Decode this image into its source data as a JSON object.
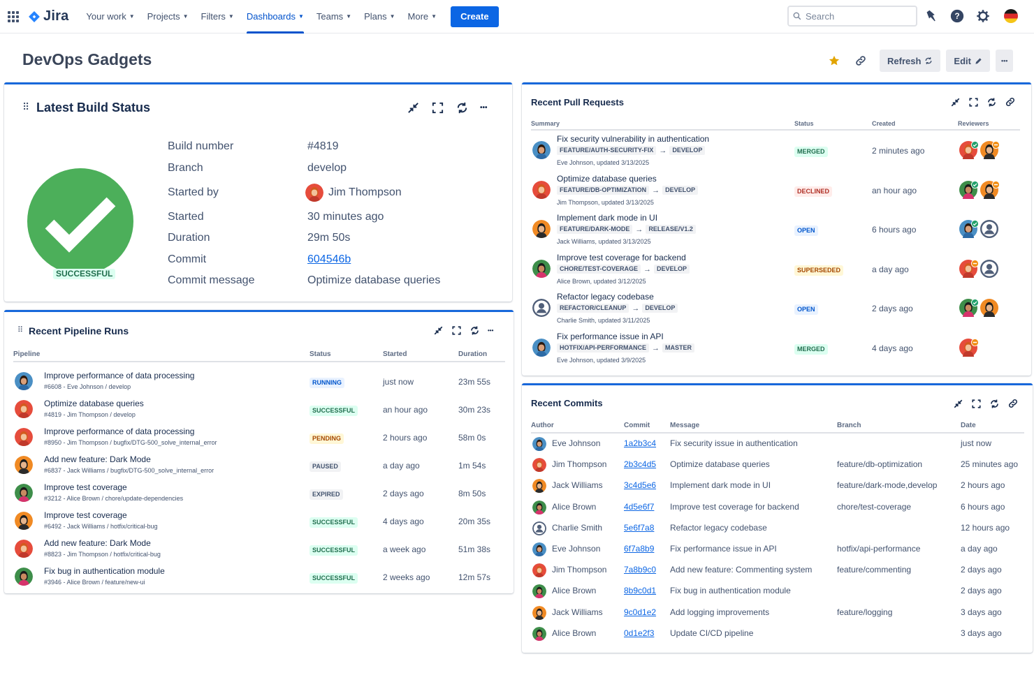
{
  "nav": {
    "logo": "Jira",
    "items": [
      {
        "label": "Your work",
        "active": false
      },
      {
        "label": "Projects",
        "active": false
      },
      {
        "label": "Filters",
        "active": false
      },
      {
        "label": "Dashboards",
        "active": true
      },
      {
        "label": "Teams",
        "active": false
      },
      {
        "label": "Plans",
        "active": false
      },
      {
        "label": "More",
        "active": false
      }
    ],
    "create_label": "Create",
    "search_placeholder": "Search",
    "icons": [
      "notifications-icon",
      "help-icon",
      "settings-icon",
      "profile-avatar"
    ]
  },
  "header": {
    "title": "DevOps Gadgets",
    "refresh_label": "Refresh",
    "edit_label": "Edit",
    "more_label": "•••"
  },
  "build": {
    "title": "Latest Build Status",
    "status": "SUCCESSFUL",
    "labels": {
      "number": "Build number",
      "branch": "Branch",
      "started_by": "Started by",
      "started": "Started",
      "duration": "Duration",
      "commit": "Commit",
      "message": "Commit message"
    },
    "values": {
      "number": "#4819",
      "branch": "develop",
      "started_by": "Jim Thompson",
      "started": "30 minutes ago",
      "duration": "29m 50s",
      "commit": "604546b",
      "message": "Optimize database queries"
    }
  },
  "pipelines": {
    "title": "Recent Pipeline Runs",
    "columns": [
      "Pipeline",
      "Status",
      "Started",
      "Duration"
    ],
    "rows": [
      {
        "title": "Improve performance of data processing",
        "sub": "#6608 - Eve Johnson / develop",
        "status": "RUNNING",
        "tone": "blue",
        "started": "just now",
        "duration": "23m 55s",
        "avatar": "eve"
      },
      {
        "title": "Optimize database queries",
        "sub": "#4819 - Jim Thompson / develop",
        "status": "SUCCESSFUL",
        "tone": "green",
        "started": "an hour ago",
        "duration": "30m 23s",
        "avatar": "jim"
      },
      {
        "title": "Improve performance of data processing",
        "sub": "#8950 - Jim Thompson / bugfix/DTG-500_solve_internal_error",
        "status": "PENDING",
        "tone": "yellow",
        "started": "2 hours ago",
        "duration": "58m 0s",
        "avatar": "jim"
      },
      {
        "title": "Add new feature: Dark Mode",
        "sub": "#6837 - Jack Williams / bugfix/DTG-500_solve_internal_error",
        "status": "PAUSED",
        "tone": "grey",
        "started": "a day ago",
        "duration": "1m 54s",
        "avatar": "jack"
      },
      {
        "title": "Improve test coverage",
        "sub": "#3212 - Alice Brown / chore/update-dependencies",
        "status": "EXPIRED",
        "tone": "grey",
        "started": "2 days ago",
        "duration": "8m 50s",
        "avatar": "alice"
      },
      {
        "title": "Improve test coverage",
        "sub": "#6492 - Jack Williams / hotfix/critical-bug",
        "status": "SUCCESSFUL",
        "tone": "green",
        "started": "4 days ago",
        "duration": "20m 35s",
        "avatar": "jack"
      },
      {
        "title": "Add new feature: Dark Mode",
        "sub": "#8823 - Jim Thompson / hotfix/critical-bug",
        "status": "SUCCESSFUL",
        "tone": "green",
        "started": "a week ago",
        "duration": "51m 38s",
        "avatar": "jim"
      },
      {
        "title": "Fix bug in authentication module",
        "sub": "#3946 - Alice Brown / feature/new-ui",
        "status": "SUCCESSFUL",
        "tone": "green",
        "started": "2 weeks ago",
        "duration": "12m 57s",
        "avatar": "alice"
      }
    ]
  },
  "pull_requests": {
    "title": "Recent Pull Requests",
    "columns": [
      "Summary",
      "Status",
      "Created",
      "Reviewers"
    ],
    "rows": [
      {
        "title": "Fix security vulnerability in authentication",
        "source": "FEATURE/AUTH-SECURITY-FIX",
        "target": "DEVELOP",
        "sub": "Eve Johnson, updated 3/13/2025",
        "status": "MERGED",
        "tone": "green",
        "created": "2 minutes ago",
        "avatar": "eve",
        "reviewers": [
          {
            "who": "jim",
            "badge": "approved"
          },
          {
            "who": "jack",
            "badge": "needs-work"
          }
        ]
      },
      {
        "title": "Optimize database queries",
        "source": "FEATURE/DB-OPTIMIZATION",
        "target": "DEVELOP",
        "sub": "Jim Thompson, updated 3/13/2025",
        "status": "DECLINED",
        "tone": "red",
        "created": "an hour ago",
        "avatar": "jim",
        "reviewers": [
          {
            "who": "alice",
            "badge": "approved"
          },
          {
            "who": "jack",
            "badge": "needs-work"
          }
        ]
      },
      {
        "title": "Implement dark mode in UI",
        "source": "FEATURE/DARK-MODE",
        "target": "RELEASE/V1.2",
        "sub": "Jack Williams, updated 3/13/2025",
        "status": "OPEN",
        "tone": "blue",
        "created": "6 hours ago",
        "avatar": "jack",
        "reviewers": [
          {
            "who": "eve",
            "badge": "approved"
          },
          {
            "who": "charlie",
            "badge": "none"
          }
        ]
      },
      {
        "title": "Improve test coverage for backend",
        "source": "CHORE/TEST-COVERAGE",
        "target": "DEVELOP",
        "sub": "Alice Brown, updated 3/12/2025",
        "status": "SUPERSEDED",
        "tone": "yellow",
        "created": "a day ago",
        "avatar": "alice",
        "reviewers": [
          {
            "who": "jim",
            "badge": "needs-work"
          },
          {
            "who": "charlie",
            "badge": "none"
          }
        ]
      },
      {
        "title": "Refactor legacy codebase",
        "source": "REFACTOR/CLEANUP",
        "target": "DEVELOP",
        "sub": "Charlie Smith, updated 3/11/2025",
        "status": "OPEN",
        "tone": "blue",
        "created": "2 days ago",
        "avatar": "charlie",
        "reviewers": [
          {
            "who": "alice",
            "badge": "approved"
          },
          {
            "who": "jack",
            "badge": "none"
          }
        ]
      },
      {
        "title": "Fix performance issue in API",
        "source": "HOTFIX/API-PERFORMANCE",
        "target": "MASTER",
        "sub": "Eve Johnson, updated 3/9/2025",
        "status": "MERGED",
        "tone": "green",
        "created": "4 days ago",
        "avatar": "eve",
        "reviewers": [
          {
            "who": "jim",
            "badge": "needs-work"
          }
        ]
      }
    ]
  },
  "commits": {
    "title": "Recent Commits",
    "columns": [
      "Author",
      "Commit",
      "Message",
      "Branch",
      "Date"
    ],
    "rows": [
      {
        "author": "Eve Johnson",
        "avatar": "eve",
        "hash": "1a2b3c4",
        "message": "Fix security issue in authentication",
        "branch": "",
        "date": "just now"
      },
      {
        "author": "Jim Thompson",
        "avatar": "jim",
        "hash": "2b3c4d5",
        "message": "Optimize database queries",
        "branch": "feature/db-optimization",
        "date": "25 minutes ago"
      },
      {
        "author": "Jack Williams",
        "avatar": "jack",
        "hash": "3c4d5e6",
        "message": "Implement dark mode in UI",
        "branch": "feature/dark-mode,develop",
        "date": "2 hours ago"
      },
      {
        "author": "Alice Brown",
        "avatar": "alice",
        "hash": "4d5e6f7",
        "message": "Improve test coverage for backend",
        "branch": "chore/test-coverage",
        "date": "6 hours ago"
      },
      {
        "author": "Charlie Smith",
        "avatar": "charlie",
        "hash": "5e6f7a8",
        "message": "Refactor legacy codebase",
        "branch": "",
        "date": "12 hours ago"
      },
      {
        "author": "Eve Johnson",
        "avatar": "eve",
        "hash": "6f7a8b9",
        "message": "Fix performance issue in API",
        "branch": "hotfix/api-performance",
        "date": "a day ago"
      },
      {
        "author": "Jim Thompson",
        "avatar": "jim",
        "hash": "7a8b9c0",
        "message": "Add new feature: Commenting system",
        "branch": "feature/commenting",
        "date": "2 days ago"
      },
      {
        "author": "Alice Brown",
        "avatar": "alice",
        "hash": "8b9c0d1",
        "message": "Fix bug in authentication module",
        "branch": "",
        "date": "2 days ago"
      },
      {
        "author": "Jack Williams",
        "avatar": "jack",
        "hash": "9c0d1e2",
        "message": "Add logging improvements",
        "branch": "feature/logging",
        "date": "3 days ago"
      },
      {
        "author": "Alice Brown",
        "avatar": "alice",
        "hash": "0d1e2f3",
        "message": "Update CI/CD pipeline",
        "branch": "",
        "date": "3 days ago"
      }
    ]
  },
  "colors": {
    "brand_blue": "#0c66e4",
    "success_green": "#4caf5a",
    "panel_accent": "#1868db",
    "star": "#e2a400",
    "lozenge_green": "#216e4e",
    "lozenge_red": "#ae2e24",
    "lozenge_blue": "#0055cc",
    "lozenge_yellow": "#a54800",
    "lozenge_grey": "#44546f"
  }
}
